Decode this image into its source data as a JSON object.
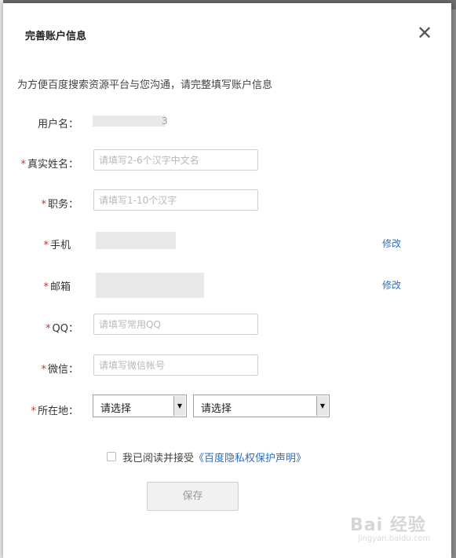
{
  "dialog": {
    "title": "完善账户信息",
    "close_glyph": "✕",
    "intro": "为方便百度搜索资源平台与您沟通，请完整填写账户信息"
  },
  "form": {
    "required_mark": "*",
    "username": {
      "label": "用户名：",
      "value": "3"
    },
    "real_name": {
      "label": "真实姓名：",
      "placeholder": "请填写2-6个汉字中文名"
    },
    "position": {
      "label": "职务：",
      "placeholder": "请填写1-10个汉字"
    },
    "phone": {
      "label": "手机",
      "edit": "修改"
    },
    "email": {
      "label": "邮箱",
      "edit": "修改"
    },
    "qq": {
      "label": "QQ：",
      "placeholder": "请填写常用QQ"
    },
    "wechat": {
      "label": "微信：",
      "placeholder": "请填写微信帐号"
    },
    "location": {
      "label": "所在地：",
      "select1": "请选择",
      "select2": "请选择"
    }
  },
  "agreement": {
    "text": "我已阅读并接受",
    "policy": "《百度隐私权保护声明》"
  },
  "save_button": "保存",
  "watermark": {
    "brand": "Bai 经验",
    "url": "jingyan.baidu.com"
  },
  "colors": {
    "accent_link": "#2f6fba",
    "required": "#c0392b"
  }
}
